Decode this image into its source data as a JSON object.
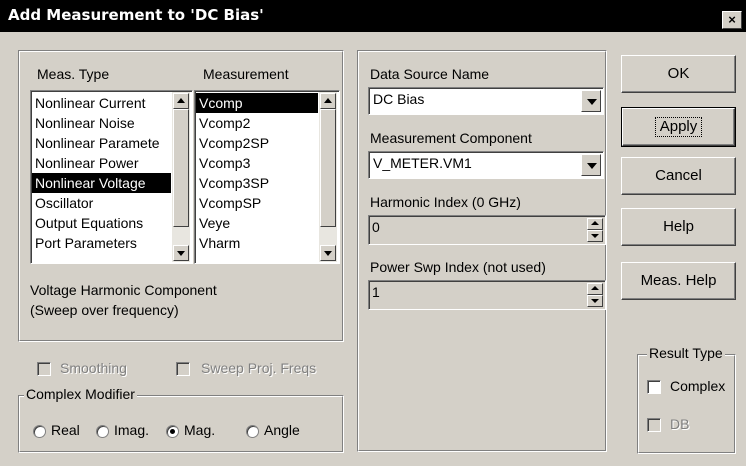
{
  "window": {
    "title": "Add Measurement to 'DC Bias'",
    "close_label": "×"
  },
  "meas_type": {
    "header": "Meas. Type",
    "items": [
      "Nonlinear Current",
      "Nonlinear Noise",
      "Nonlinear Paramete",
      "Nonlinear Power",
      "Nonlinear Voltage",
      "Oscillator",
      "Output Equations",
      "Port Parameters"
    ],
    "selected": "Nonlinear Voltage"
  },
  "measurement": {
    "header": "Measurement",
    "items": [
      "Vcomp",
      "Vcomp2",
      "Vcomp2SP",
      "Vcomp3",
      "Vcomp3SP",
      "VcompSP",
      "Veye",
      "Vharm"
    ],
    "selected": "Vcomp"
  },
  "description": {
    "line1": "Voltage Harmonic Component",
    "line2": "(Sweep over frequency)"
  },
  "options": {
    "smoothing": "Smoothing",
    "sweep_proj": "Sweep Proj. Freqs"
  },
  "complex_modifier": {
    "legend": "Complex Modifier",
    "options": [
      "Real",
      "Imag.",
      "Mag.",
      "Angle"
    ],
    "selected": "Mag."
  },
  "params": {
    "data_source_label": "Data Source Name",
    "data_source_value": "DC Bias",
    "component_label": "Measurement Component",
    "component_value": "V_METER.VM1",
    "harmonic_label": "Harmonic Index (0 GHz)",
    "harmonic_value": "0",
    "power_label": "Power Swp Index (not used)",
    "power_value": "1"
  },
  "buttons": {
    "ok": "OK",
    "apply": "Apply",
    "cancel": "Cancel",
    "help": "Help",
    "meas_help": "Meas. Help"
  },
  "result_type": {
    "legend": "Result Type",
    "complex": "Complex",
    "db": "DB"
  },
  "colors": {
    "title_bg": "#000000",
    "dialog_bg": "#d4d0c8",
    "selection": "#000000",
    "disabled_text": "#808080"
  }
}
